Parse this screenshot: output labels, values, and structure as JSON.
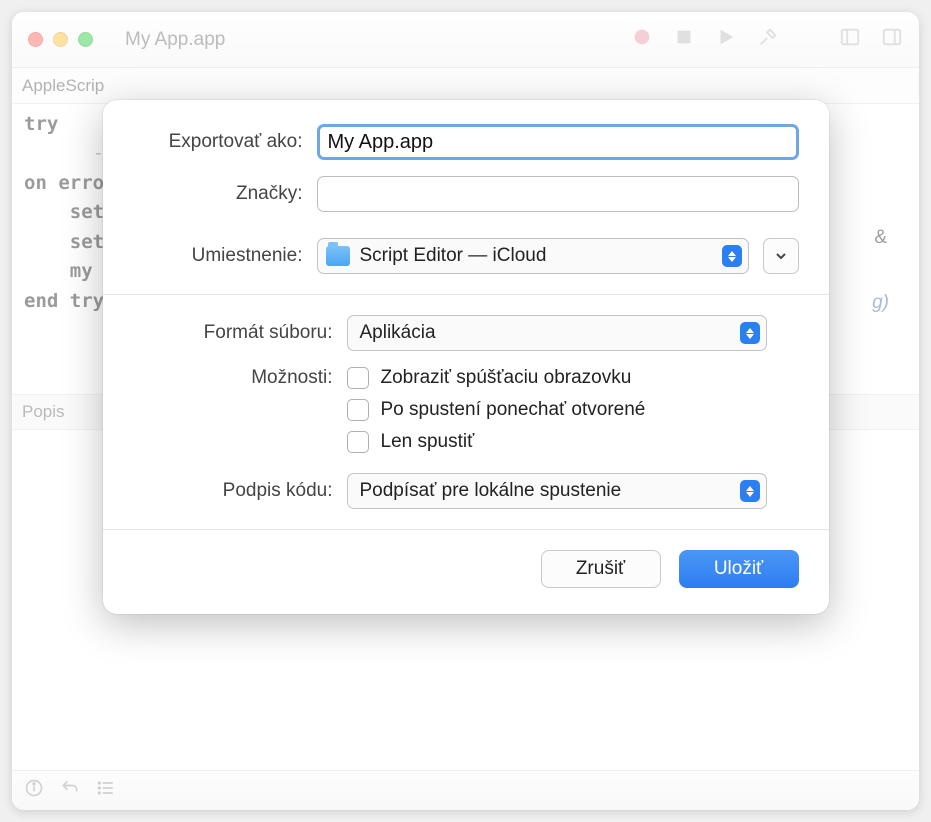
{
  "window": {
    "title": "My App.app"
  },
  "lang_row": "AppleScrip",
  "editor": {
    "lines": [
      "try",
      "      -- Y",
      "on error",
      "    set ",
      "",
      "    set ",
      "",
      "    my ",
      "end try"
    ],
    "amp": "&",
    "tail": "g)"
  },
  "desc_header": "Popis",
  "sheet": {
    "export_label": "Exportovať ako:",
    "export_value": "My App.app",
    "tags_label": "Značky:",
    "tags_value": "",
    "location_label": "Umiestnenie:",
    "location_value": "Script Editor — iCloud",
    "format_label": "Formát súboru:",
    "format_value": "Aplikácia",
    "options_label": "Možnosti:",
    "options": [
      "Zobraziť spúšťaciu obrazovku",
      "Po spustení ponechať otvorené",
      "Len spustiť"
    ],
    "codesign_label": "Podpis kódu:",
    "codesign_value": "Podpísať pre lokálne spustenie",
    "cancel": "Zrušiť",
    "save": "Uložiť"
  },
  "icons": {
    "record": "record-icon",
    "stop": "stop-icon",
    "play": "play-icon",
    "hammer": "hammer-icon",
    "panel_right": "panel-right-icon",
    "panel_left": "panel-left-icon"
  }
}
